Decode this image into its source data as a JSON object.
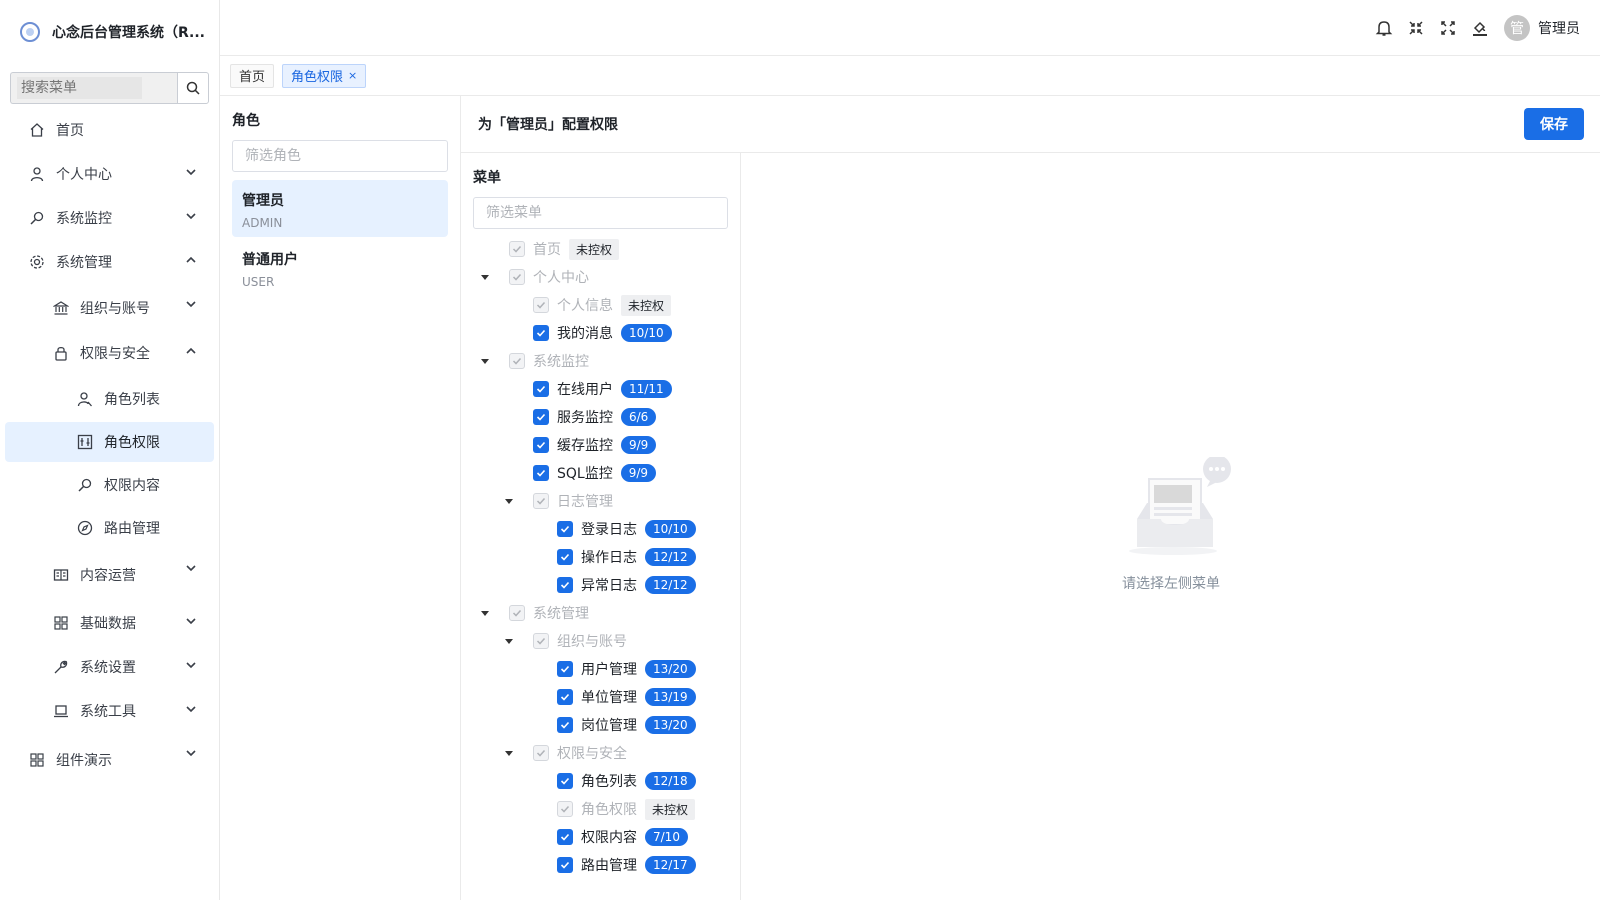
{
  "app": {
    "title": "心念后台管理系统（R..."
  },
  "search": {
    "placeholder": "搜索菜单"
  },
  "sidebar": {
    "items": [
      {
        "label": "首页"
      },
      {
        "label": "个人中心"
      },
      {
        "label": "系统监控"
      },
      {
        "label": "系统管理"
      },
      {
        "label": "组织与账号"
      },
      {
        "label": "权限与安全"
      },
      {
        "label": "角色列表"
      },
      {
        "label": "角色权限"
      },
      {
        "label": "权限内容"
      },
      {
        "label": "路由管理"
      },
      {
        "label": "内容运营"
      },
      {
        "label": "基础数据"
      },
      {
        "label": "系统设置"
      },
      {
        "label": "系统工具"
      },
      {
        "label": "组件演示"
      }
    ]
  },
  "header": {
    "username": "管理员",
    "avatar_char": "管"
  },
  "tabs": [
    {
      "label": "首页"
    },
    {
      "label": "角色权限",
      "close": "×"
    }
  ],
  "roles": {
    "title": "角色",
    "filter_placeholder": "筛选角色",
    "list": [
      {
        "name": "管理员",
        "code": "ADMIN"
      },
      {
        "name": "普通用户",
        "code": "USER"
      }
    ]
  },
  "perm": {
    "title": "为「管理员」配置权限",
    "save_label": "保存",
    "menu_title": "菜单",
    "menu_filter_placeholder": "筛选菜单",
    "tree": [
      {
        "label": "首页",
        "badge": "未控权"
      },
      {
        "label": "个人中心"
      },
      {
        "label": "个人信息",
        "badge": "未控权"
      },
      {
        "label": "我的消息",
        "badge": "10/10"
      },
      {
        "label": "系统监控"
      },
      {
        "label": "在线用户",
        "badge": "11/11"
      },
      {
        "label": "服务监控",
        "badge": "6/6"
      },
      {
        "label": "缓存监控",
        "badge": "9/9"
      },
      {
        "label": "SQL监控",
        "badge": "9/9"
      },
      {
        "label": "日志管理"
      },
      {
        "label": "登录日志",
        "badge": "10/10"
      },
      {
        "label": "操作日志",
        "badge": "12/12"
      },
      {
        "label": "异常日志",
        "badge": "12/12"
      },
      {
        "label": "系统管理"
      },
      {
        "label": "组织与账号"
      },
      {
        "label": "用户管理",
        "badge": "13/20"
      },
      {
        "label": "单位管理",
        "badge": "13/19"
      },
      {
        "label": "岗位管理",
        "badge": "13/20"
      },
      {
        "label": "权限与安全"
      },
      {
        "label": "角色列表",
        "badge": "12/18"
      },
      {
        "label": "角色权限",
        "badge": "未控权"
      },
      {
        "label": "权限内容",
        "badge": "7/10"
      },
      {
        "label": "路由管理",
        "badge": "12/17"
      }
    ]
  },
  "empty": {
    "text": "请选择左侧菜单"
  },
  "colors": {
    "primary": "#1a6ee6",
    "active_bg": "#e6f1ff"
  }
}
